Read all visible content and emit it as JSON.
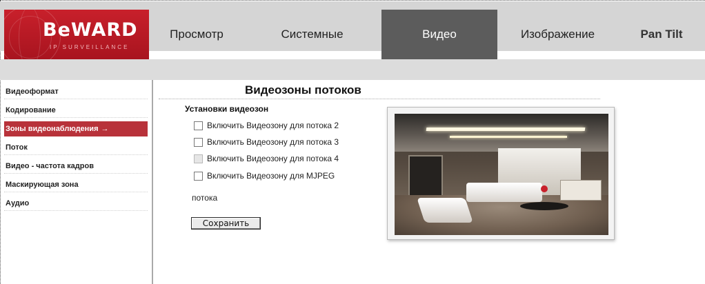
{
  "logo": {
    "brand": "BeWARD",
    "tagline": "IP SURVEILLANCE"
  },
  "nav": {
    "tabs": [
      {
        "label": "Просмотр"
      },
      {
        "label": "Системные"
      },
      {
        "label": "Видео"
      },
      {
        "label": "Изображение"
      },
      {
        "label": "Pan Tilt"
      }
    ],
    "active": "Видео"
  },
  "sidebar": {
    "items": [
      {
        "label": "Видеоформат"
      },
      {
        "label": "Кодирование"
      },
      {
        "label": "Зоны видеонаблюдения"
      },
      {
        "label": "Поток"
      },
      {
        "label": "Видео - частота кадров"
      },
      {
        "label": "Маскирующая зона"
      },
      {
        "label": "Аудио"
      }
    ],
    "active_arrow": "→"
  },
  "main": {
    "title": "Видеозоны потоков",
    "section": "Установки видеозон",
    "checkboxes": [
      {
        "label": "Включить Видеозону для потока 2",
        "checked": false,
        "enabled": true
      },
      {
        "label": "Включить Видеозону для потока 3",
        "checked": false,
        "enabled": true
      },
      {
        "label": "Включить Видеозону для потока 4",
        "checked": false,
        "enabled": false
      },
      {
        "label": "Включить Видеозону для MJPEG",
        "checked": false,
        "enabled": true
      }
    ],
    "checkbox_continuation": "потока",
    "save_label": "Сохранить"
  },
  "colors": {
    "brand_red": "#c8202b",
    "active_tab": "#5c5c5c",
    "active_sidebar": "#b8323a"
  }
}
